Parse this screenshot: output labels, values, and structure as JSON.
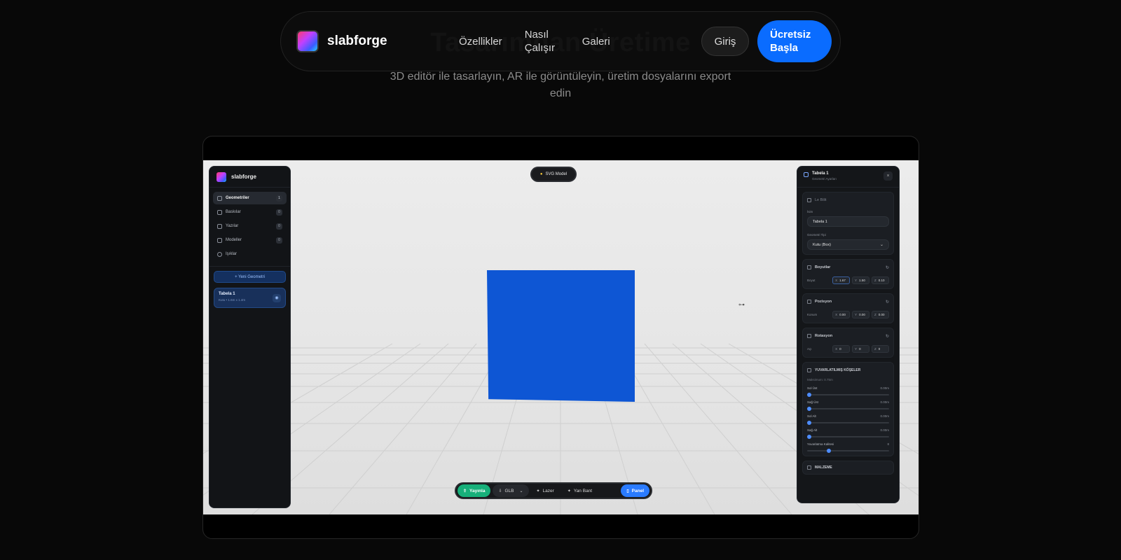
{
  "hero": {
    "title": "Tasarımdan Üretime",
    "subtitle": "3D editör ile tasarlayın, AR ile görüntüleyin, üretim dosyalarını export edin"
  },
  "nav": {
    "brand": "slabforge",
    "links": [
      "Özellikler",
      "Nasıl Çalışır",
      "Galeri"
    ],
    "login": "Giriş",
    "cta": "Ücretsiz Başla"
  },
  "colors": {
    "accent": "#0a6cff",
    "cube": "#0e56d4",
    "publish": "#17b07a"
  },
  "editor": {
    "brand": "slabforge",
    "sidebar": [
      {
        "label": "Geometriler",
        "count": "1",
        "icon": "cube-icon"
      },
      {
        "label": "Baskılar",
        "count": "0",
        "icon": "layers-icon"
      },
      {
        "label": "Yazılar",
        "count": "0",
        "icon": "text-icon"
      },
      {
        "label": "Modeller",
        "count": "0",
        "icon": "model-icon"
      },
      {
        "label": "Işıklar",
        "count": "",
        "icon": "bulb-icon"
      }
    ],
    "new_geometry": "+ Yeni Geometri",
    "item": {
      "title": "Tabela 1",
      "subtitle": "Kutu • 1.6m x 1.4m"
    },
    "svg_model": "SVG Model",
    "toolbar": {
      "publish": "Yayınla",
      "glb": "GLB",
      "laser": "Lazer",
      "sideband": "Yan Bant",
      "panel": "Panel"
    },
    "props": {
      "title": "Tabela 1",
      "subtitle": "Geometri Ayarları",
      "close": "×",
      "info_header": "Le Bilit",
      "name_label": "İsim",
      "name_value": "Tabela 1",
      "type_label": "Geometri Tipi",
      "type_value": "Kutu (Box)",
      "size_header": "Boyutlar",
      "size_label": "Boyut",
      "size": {
        "x": "1.67",
        "y": "1.50",
        "z": "0.10"
      },
      "pos_header": "Pozisyon",
      "pos_label": "Konum",
      "pos": {
        "x": "0.00",
        "y": "0.00",
        "z": "0.00"
      },
      "rot_header": "Rotasyon",
      "rot_label": "Açı",
      "rot": {
        "x": "0",
        "y": "0",
        "z": "0"
      },
      "corners_header": "YUVARLATILMIŞ KÖŞELER",
      "corners_max": "Maksimum: 0.75m",
      "corners": [
        {
          "label": "Sol Üst",
          "value": "0.00m",
          "pos": 0
        },
        {
          "label": "Sağ Üst",
          "value": "0.00m",
          "pos": 0
        },
        {
          "label": "Sol Alt",
          "value": "0.00m",
          "pos": 0
        },
        {
          "label": "Sağ Alt",
          "value": "0.00m",
          "pos": 0
        },
        {
          "label": "Yuvarlatma Kalitesi",
          "value": "8",
          "pos": 0.25
        }
      ],
      "material_header": "MALZEME"
    }
  }
}
